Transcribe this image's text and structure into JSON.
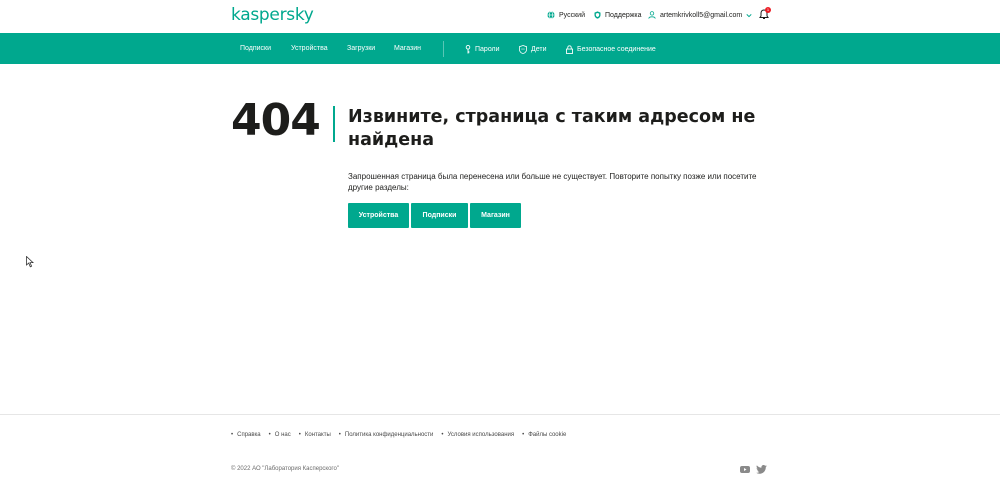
{
  "header": {
    "logo": "kaspersky",
    "language": "Русский",
    "support": "Поддержка",
    "account": "artemkrivkoll5@gmail.com",
    "notifications_count": "1"
  },
  "nav": {
    "items": [
      "Подписки",
      "Устройства",
      "Загрузки",
      "Магазин"
    ],
    "passwords": "Пароли",
    "kids": "Дети",
    "secure_connection": "Безопасное соединение"
  },
  "error": {
    "code": "404",
    "title": "Извините, страница с таким адресом не найдена",
    "description": "Запрошенная страница была перенесена или больше не существует. Повторите попытку позже или посетите другие разделы:",
    "buttons": [
      "Устройства",
      "Подписки",
      "Магазин"
    ]
  },
  "footer": {
    "links": [
      "Справка",
      "О нас",
      "Контакты",
      "Политика конфиденциальности",
      "Условия использования",
      "Файлы cookie"
    ],
    "copyright": "© 2022 АО \"Лаборатория Касперского\""
  },
  "colors": {
    "accent": "#00a88e",
    "badge": "#ed1c24"
  },
  "icons": [
    "globe-icon",
    "shield-icon",
    "user-icon",
    "chevron-down-icon",
    "bell-icon",
    "key-icon",
    "kids-shield-icon",
    "lock-icon",
    "youtube-icon",
    "twitter-icon",
    "cursor-icon"
  ]
}
